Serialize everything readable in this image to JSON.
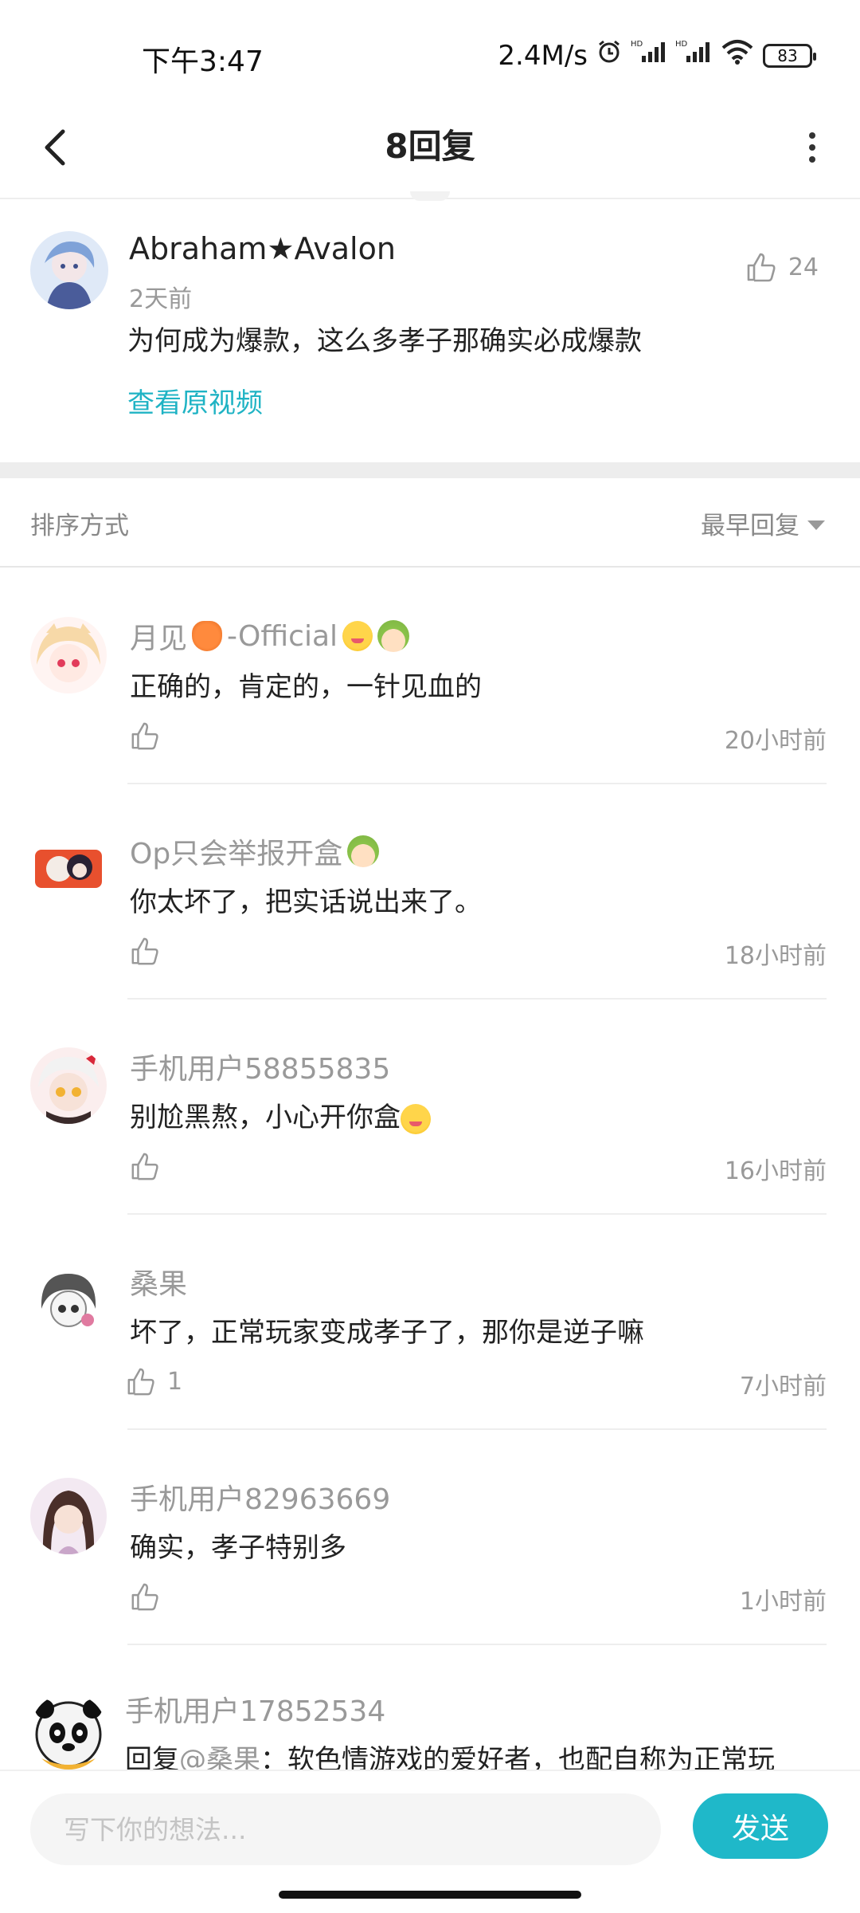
{
  "status_bar": {
    "time": "下午3:47",
    "net_speed": "2.4M/s",
    "battery": "83",
    "icons": [
      "alarm-icon",
      "hd-signal-icon",
      "hd-signal-icon",
      "wifi-icon",
      "battery-icon"
    ]
  },
  "header": {
    "title": "8回复",
    "back_icon": "chevron-left-icon",
    "more_icon": "more-vertical-icon"
  },
  "main_comment": {
    "author": "Abraham★Avalon",
    "time": "2天前",
    "text": "为何成为爆款，这么多孝子那确实必成爆款",
    "link": "查看原视频",
    "likes": "24"
  },
  "sort": {
    "label": "排序方式",
    "selected": "最早回复"
  },
  "replies": [
    {
      "author": "月见",
      "author_suffix": "-Official",
      "text": "正确的，肯定的，一针见血的",
      "likes": "",
      "time": "20小时前"
    },
    {
      "author": "Op只会举报开盒",
      "text": "你太坏了，把实话说出来了。",
      "likes": "",
      "time": "18小时前"
    },
    {
      "author": "手机用户58855835",
      "text": "别尬黑熬，小心开你盒",
      "likes": "",
      "time": "16小时前"
    },
    {
      "author": "桑果",
      "text": "坏了，正常玩家变成孝子了，那你是逆子嘛",
      "likes": "1",
      "time": "7小时前"
    },
    {
      "author": "手机用户82963669",
      "text": "确实，孝子特别多",
      "likes": "",
      "time": "1小时前"
    },
    {
      "author": "手机用户17852534",
      "reply_prefix": "回复",
      "mention": "@桑果",
      "text": "：软色情游戏的爱好者，也配自称为正常玩",
      "likes": "",
      "time": ""
    }
  ],
  "input": {
    "placeholder": "写下你的想法...",
    "value": "",
    "send_label": "发送"
  },
  "colors": {
    "accent": "#1fb8c9",
    "link": "#1fb3c4",
    "muted": "#999999"
  }
}
